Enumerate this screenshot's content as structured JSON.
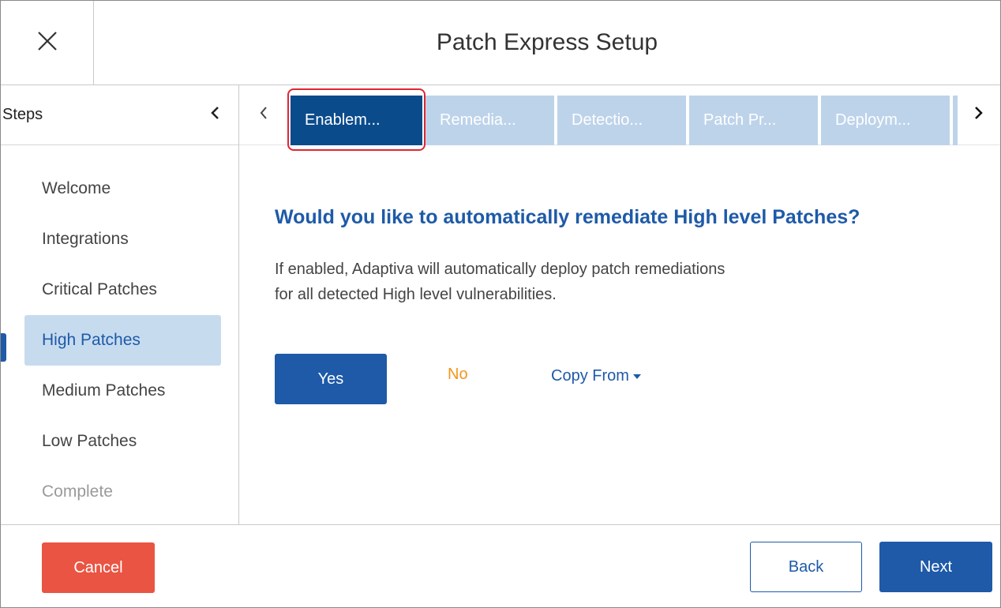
{
  "header": {
    "title": "Patch Express Setup",
    "close_icon": "close-icon"
  },
  "sidebar": {
    "heading": "Steps",
    "collapse_icon": "chevron-left-icon",
    "items": [
      {
        "label": "Welcome",
        "state": "normal"
      },
      {
        "label": "Integrations",
        "state": "normal"
      },
      {
        "label": "Critical Patches",
        "state": "normal"
      },
      {
        "label": "High Patches",
        "state": "active"
      },
      {
        "label": "Medium Patches",
        "state": "normal"
      },
      {
        "label": "Low Patches",
        "state": "normal"
      },
      {
        "label": "Complete",
        "state": "disabled"
      }
    ]
  },
  "tabs": {
    "prev_icon": "chevron-left-icon",
    "next_icon": "chevron-right-icon",
    "items": [
      {
        "label": "Enablem...",
        "active": true
      },
      {
        "label": "Remedia...",
        "active": false
      },
      {
        "label": "Detectio...",
        "active": false
      },
      {
        "label": "Patch Pr...",
        "active": false
      },
      {
        "label": "Deploym...",
        "active": false
      }
    ]
  },
  "main": {
    "question": "Would you like to automatically remediate High level Patches?",
    "description_line1": "If enabled, Adaptiva will automatically deploy patch remediations",
    "description_line2": "for all detected High level vulnerabilities.",
    "yes_label": "Yes",
    "no_label": "No",
    "copy_from_label": "Copy From",
    "copy_from_icon": "caret-down-icon"
  },
  "footer": {
    "cancel_label": "Cancel",
    "back_label": "Back",
    "next_label": "Next"
  },
  "colors": {
    "accent": "#1e5aa8",
    "active_tab": "#0a4b8c",
    "inactive_tab": "#bdd3ea",
    "active_step_bg": "#c7dbef",
    "cancel": "#ea5442",
    "no_option": "#f3961d",
    "highlight": "#e0262f"
  }
}
